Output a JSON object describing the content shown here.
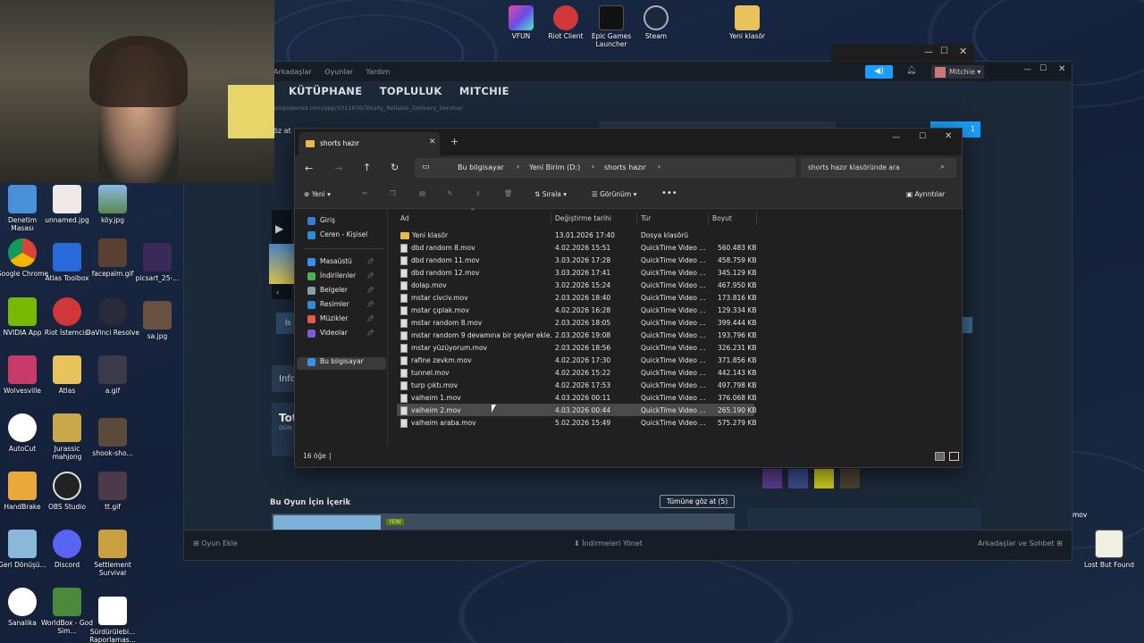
{
  "desktop_top": [
    {
      "label": "VFUN"
    },
    {
      "label": "Riot Client"
    },
    {
      "label": "Epic Games Launcher"
    },
    {
      "label": "Steam"
    },
    {
      "label": "Yeni klasör"
    }
  ],
  "desktop_left": [
    {
      "label": "Denetim Masası"
    },
    {
      "label": "unnamed.jpg"
    },
    {
      "label": "köy.jpg"
    },
    {
      "label": "Google Chrome"
    },
    {
      "label": "Atlas Toolbox"
    },
    {
      "label": "facepalm.gif"
    },
    {
      "label": "picsart_25-..."
    },
    {
      "label": "NVIDIA App"
    },
    {
      "label": "Riot İstemcisi"
    },
    {
      "label": "DaVinci Resolve"
    },
    {
      "label": "sa.jpg"
    },
    {
      "label": "Wolvesville"
    },
    {
      "label": "Atlas"
    },
    {
      "label": "a.gif"
    },
    {
      "label": "AutoCut"
    },
    {
      "label": "Jurassic mahjong"
    },
    {
      "label": "shook-sho..."
    },
    {
      "label": "HandBrake"
    },
    {
      "label": "OBS Studio"
    },
    {
      "label": "tt.gif"
    },
    {
      "label": "Geri Dönüşü..."
    },
    {
      "label": "Discord"
    },
    {
      "label": "Settlement Survival"
    },
    {
      "label": "Sanalika"
    },
    {
      "label": "WorldBox - God Sim..."
    },
    {
      "label": "Sürdürülebi... Raporlamas..."
    }
  ],
  "desktop_right": {
    "lost_but_found": "Lost But Found",
    "mov": "mov"
  },
  "steam": {
    "menu": [
      "Arkadaşlar",
      "Oyunlar",
      "Yardım"
    ],
    "nav": [
      "KÜTÜPHANE",
      "TOPLULUK",
      "MITCHIE"
    ],
    "url": "ampowered.com/app/1011670/Totally_Reliable_Delivery_Service/",
    "user": "Mitchie",
    "content_header": "Bu Oyun İçin İçerik",
    "content_button": "Tümüne göz at (5)",
    "new_badge": "YENİ",
    "info_label": "Info",
    "tot_label": "Tot",
    "gun_label": "GÜN",
    "is_label": "İs",
    "goz_at": "öz at",
    "btn_1": "1",
    "bottom_add": "Oyun Ekle",
    "bottom_downloads": "İndirmeleri Yönet",
    "bottom_friends": "Arkadaşlar ve Sohbet"
  },
  "explorer": {
    "tab_title": "shorts hazır",
    "breadcrumb": [
      "Bu bilgisayar",
      "Yeni Birim (D:)",
      "shorts hazır"
    ],
    "search_placeholder": "shorts hazır klasöründe ara",
    "toolbar": {
      "new": "Yeni",
      "sort": "Sırala",
      "view": "Görünüm",
      "details": "Ayrıntılar"
    },
    "sidebar": [
      {
        "label": "Giriş",
        "color": "#3a7bd5"
      },
      {
        "label": "Ceren - Kişisel",
        "color": "#2a8fd8"
      },
      {
        "label": "Masaüstü",
        "color": "#3a8ee8",
        "pin": true
      },
      {
        "label": "İndirilenler",
        "color": "#4caf50",
        "pin": true
      },
      {
        "label": "Belgeler",
        "color": "#8a9bb0",
        "pin": true
      },
      {
        "label": "Resimler",
        "color": "#2e8bd6",
        "pin": true
      },
      {
        "label": "Müzikler",
        "color": "#e05a4f",
        "pin": true
      },
      {
        "label": "Videolar",
        "color": "#7b5cd6",
        "pin": true
      },
      {
        "label": "Bu bilgisayar",
        "color": "#3a8ee8",
        "selected": true
      }
    ],
    "columns": [
      "Ad",
      "Değiştirme tarihi",
      "Tür",
      "Boyut"
    ],
    "files": [
      {
        "name": "Yeni klasör",
        "date": "13.01.2026 17:40",
        "type": "Dosya klasörü",
        "size": "",
        "folder": true
      },
      {
        "name": "dbd random 8.mov",
        "date": "4.02.2026 15:51",
        "type": "QuickTime Video ...",
        "size": "560.483 KB"
      },
      {
        "name": "dbd random 11.mov",
        "date": "3.03.2026 17:28",
        "type": "QuickTime Video ...",
        "size": "458.759 KB"
      },
      {
        "name": "dbd random 12.mov",
        "date": "3.03.2026 17:41",
        "type": "QuickTime Video ...",
        "size": "345.129 KB"
      },
      {
        "name": "dolap.mov",
        "date": "3.02.2026 15:24",
        "type": "QuickTime Video ...",
        "size": "467.950 KB"
      },
      {
        "name": "mstar civciv.mov",
        "date": "2.03.2026 18:40",
        "type": "QuickTime Video ...",
        "size": "173.816 KB"
      },
      {
        "name": "mstar çıplak.mov",
        "date": "4.02.2026 16:28",
        "type": "QuickTime Video ...",
        "size": "129.334 KB"
      },
      {
        "name": "mstar random 8.mov",
        "date": "2.03.2026 18:05",
        "type": "QuickTime Video ...",
        "size": "399.444 KB"
      },
      {
        "name": "mstar random 9 devamına bir şeyler ekle...",
        "date": "2.03.2026 19:08",
        "type": "QuickTime Video ...",
        "size": "193.796 KB"
      },
      {
        "name": "mstar yüzüyorum.mov",
        "date": "2.03.2026 18:56",
        "type": "QuickTime Video ...",
        "size": "326.231 KB"
      },
      {
        "name": "rafine zevkm.mov",
        "date": "4.02.2026 17:30",
        "type": "QuickTime Video ...",
        "size": "371.856 KB"
      },
      {
        "name": "tunnel.mov",
        "date": "4.02.2026 15:22",
        "type": "QuickTime Video ...",
        "size": "442.143 KB"
      },
      {
        "name": "turp çıktı.mov",
        "date": "4.02.2026 17:53",
        "type": "QuickTime Video ...",
        "size": "497.798 KB"
      },
      {
        "name": "valheim 1.mov",
        "date": "4.03.2026 00:11",
        "type": "QuickTime Video ...",
        "size": "376.068 KB"
      },
      {
        "name": "valheim 2.mov",
        "date": "4.03.2026 00:44",
        "type": "QuickTime Video ...",
        "size": "265.190 KB",
        "selected": true
      },
      {
        "name": "valheim araba.mov",
        "date": "5.02.2026 15:49",
        "type": "QuickTime Video ...",
        "size": "575.279 KB"
      }
    ],
    "status": "16 öğe"
  }
}
